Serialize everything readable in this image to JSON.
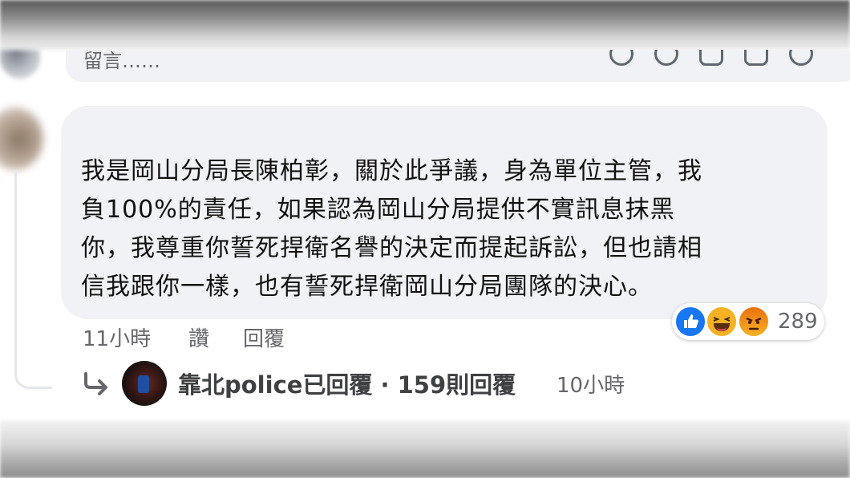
{
  "comment_input": {
    "placeholder": "留言……",
    "icons": [
      "sticker-icon",
      "emoji-icon",
      "camera-icon",
      "gif-icon",
      "extra-sticker-icon"
    ]
  },
  "comment": {
    "author": "",
    "lines": [
      "我是岡山分局長陳柏彰，關於此爭議，身為單位主管，我",
      "負100%的責任，如果認為岡山分局提供不實訊息抹黑",
      "你，我尊重你誓死捍衛名譽的決定而提起訴訟，但也請相",
      "信我跟你一樣，也有誓死捍衛岡山分局團隊的決心。"
    ],
    "reactions": {
      "types": [
        "like-icon",
        "haha-icon",
        "angry-icon"
      ],
      "count": "289"
    },
    "time": "11小時",
    "like_label": "讚",
    "reply_label": "回覆"
  },
  "replies": {
    "summary": "靠北police已回覆 · 159則回覆",
    "time": "10小時"
  },
  "colors": {
    "bubble": "#f0f2f5",
    "secondary_text": "#65676b",
    "like_blue": "#1877f2",
    "haha_yellow": "#f7b125",
    "angry_orange": "#e9710f"
  }
}
